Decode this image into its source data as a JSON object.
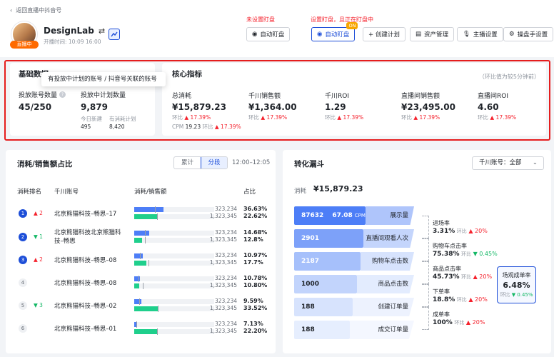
{
  "header": {
    "back_label": "返回直播中抖音号",
    "name": "DesignLab",
    "live_badge": "直播中",
    "start_time": "开播时间: 10:09 16:00",
    "hint_left": "未设置盯盘",
    "hint_right": "设置盯盘，且正在盯盘中",
    "buttons": {
      "manual_watch": "自动盯盘",
      "auto_watch": "自动盯盘",
      "on_badge": "ON",
      "create_plan": "+ 创建计划",
      "assets": "资产管理",
      "host": "主播设置",
      "operator": "操盘手设置"
    }
  },
  "basic": {
    "title": "基础数据",
    "tooltip": "有投放中计划的账号 / 抖音号关联的账号",
    "accounts_label": "投放账号数量",
    "accounts_value": "45/250",
    "plans_label": "投放中计划数量",
    "plans_value": "9,879",
    "new_label": "今日新建",
    "new_value": "495",
    "spend_label": "有消耗计划",
    "spend_value": "8,420"
  },
  "core": {
    "title": "核心指标",
    "note": "（环比值为较5分钟前）",
    "metrics": [
      {
        "label": "总消耗",
        "value": "¥15,879.23",
        "ring": "环比",
        "change": "▲ 17.39%",
        "cpm_label": "CPM",
        "cpm_value": "19.23",
        "cpm_ring": "环比",
        "cpm_change": "▲ 17.39%"
      },
      {
        "label": "千川销售额",
        "value": "¥1,364.00",
        "ring": "环比",
        "change": "▲ 17.39%"
      },
      {
        "label": "千川ROI",
        "value": "1.29",
        "ring": "环比",
        "change": "▲ 17.39%"
      },
      {
        "label": "直播间销售额",
        "value": "¥23,495.00",
        "ring": "环比",
        "change": "▲ 17.39%"
      },
      {
        "label": "直播间ROI",
        "value": "4.60",
        "ring": "环比",
        "change": "▲ 17.39%"
      }
    ]
  },
  "share": {
    "title": "消耗/销售额占比",
    "tab_total": "累计",
    "tab_segment": "分段",
    "time_range": "12:00–12:05",
    "col_rank": "消耗排名",
    "col_account": "千川账号",
    "col_ratio": "消耗/销售额",
    "col_pct": "占比",
    "rows": [
      {
        "rank": "1",
        "delta": "▲ 2",
        "dir": "up",
        "account": "北京熊猫科技–畅思–17",
        "spend": "323,234",
        "sales": "1,323,345",
        "spend_pct": "36.63%",
        "sales_pct": "22.62%",
        "b": 0.37,
        "g": 0.29
      },
      {
        "rank": "2",
        "delta": "▼ 1",
        "dir": "dn",
        "account": "北京熊猫科技北京熊猫科技–畅思",
        "spend": "323,234",
        "sales": "1,323,345",
        "spend_pct": "14.68%",
        "sales_pct": "12.8%",
        "b": 0.19,
        "g": 0.1
      },
      {
        "rank": "3",
        "delta": "▲ 2",
        "dir": "up",
        "account": "北京熊猫科技–畅思–08",
        "spend": "323,234",
        "sales": "1,323,345",
        "spend_pct": "10.97%",
        "sales_pct": "17.7%",
        "b": 0.11,
        "g": 0.15
      },
      {
        "rank": "4",
        "delta": "",
        "dir": "",
        "account": "北京熊猫科技–畅思–08",
        "spend": "323,234",
        "sales": "1,323,345",
        "spend_pct": "10.78%",
        "sales_pct": "10.80%",
        "b": 0.07,
        "g": 0.06
      },
      {
        "rank": "5",
        "delta": "▼ 3",
        "dir": "dn",
        "account": "北京熊猫科技–畅思–02",
        "spend": "323,234",
        "sales": "1,323,345",
        "spend_pct": "9.59%",
        "sales_pct": "33.52%",
        "b": 0.09,
        "g": 0.3
      },
      {
        "rank": "6",
        "delta": "",
        "dir": "",
        "account": "北京熊猫科技–畅思–01",
        "spend": "323,234",
        "sales": "1,323,345",
        "spend_pct": "7.13%",
        "sales_pct": "22.20%",
        "b": 0.04,
        "g": 0.29
      }
    ]
  },
  "funnel": {
    "title": "转化漏斗",
    "account_select": "千川账号：全部",
    "spend_label": "消耗",
    "spend_value": "¥15,879.23",
    "stages": [
      {
        "value": "87632",
        "extra": "67.08",
        "extra_unit": "CPM",
        "name": "展示量"
      },
      {
        "value": "2901",
        "name": "直播间观看人次"
      },
      {
        "value": "2187",
        "name": "购物车点击数"
      },
      {
        "value": "1000",
        "name": "商品点击数"
      },
      {
        "value": "188",
        "name": "创建订单量"
      },
      {
        "value": "188",
        "name": "成交订单量"
      }
    ],
    "rates": [
      {
        "label": "进场率",
        "value": "3.31%",
        "ring": "环比",
        "change": "▲ 20%",
        "dir": "up"
      },
      {
        "label": "购物车点击率",
        "value": "75.38%",
        "ring": "环比",
        "change": "▼ 0.45%",
        "dir": "dn"
      },
      {
        "label": "商品点击率",
        "value": "45.73%",
        "ring": "环比",
        "change": "▲ 20%",
        "dir": "up"
      },
      {
        "label": "下单率",
        "value": "18.8%",
        "ring": "环比",
        "change": "▲ 20%",
        "dir": "up"
      },
      {
        "label": "成单率",
        "value": "100%",
        "ring": "环比",
        "change": "▲ 20%",
        "dir": "up"
      }
    ],
    "scene": {
      "label": "场观成单率",
      "value": "6.48%",
      "ring": "环比",
      "change": "▼ 0.45%"
    }
  },
  "colors": {
    "accent": "#1d4ed8",
    "bar_blue": "#4d7ef7",
    "bar_green": "#1fcf8c",
    "up": "#f5222d",
    "down": "#14b866",
    "highlight": "#e51d1d"
  }
}
